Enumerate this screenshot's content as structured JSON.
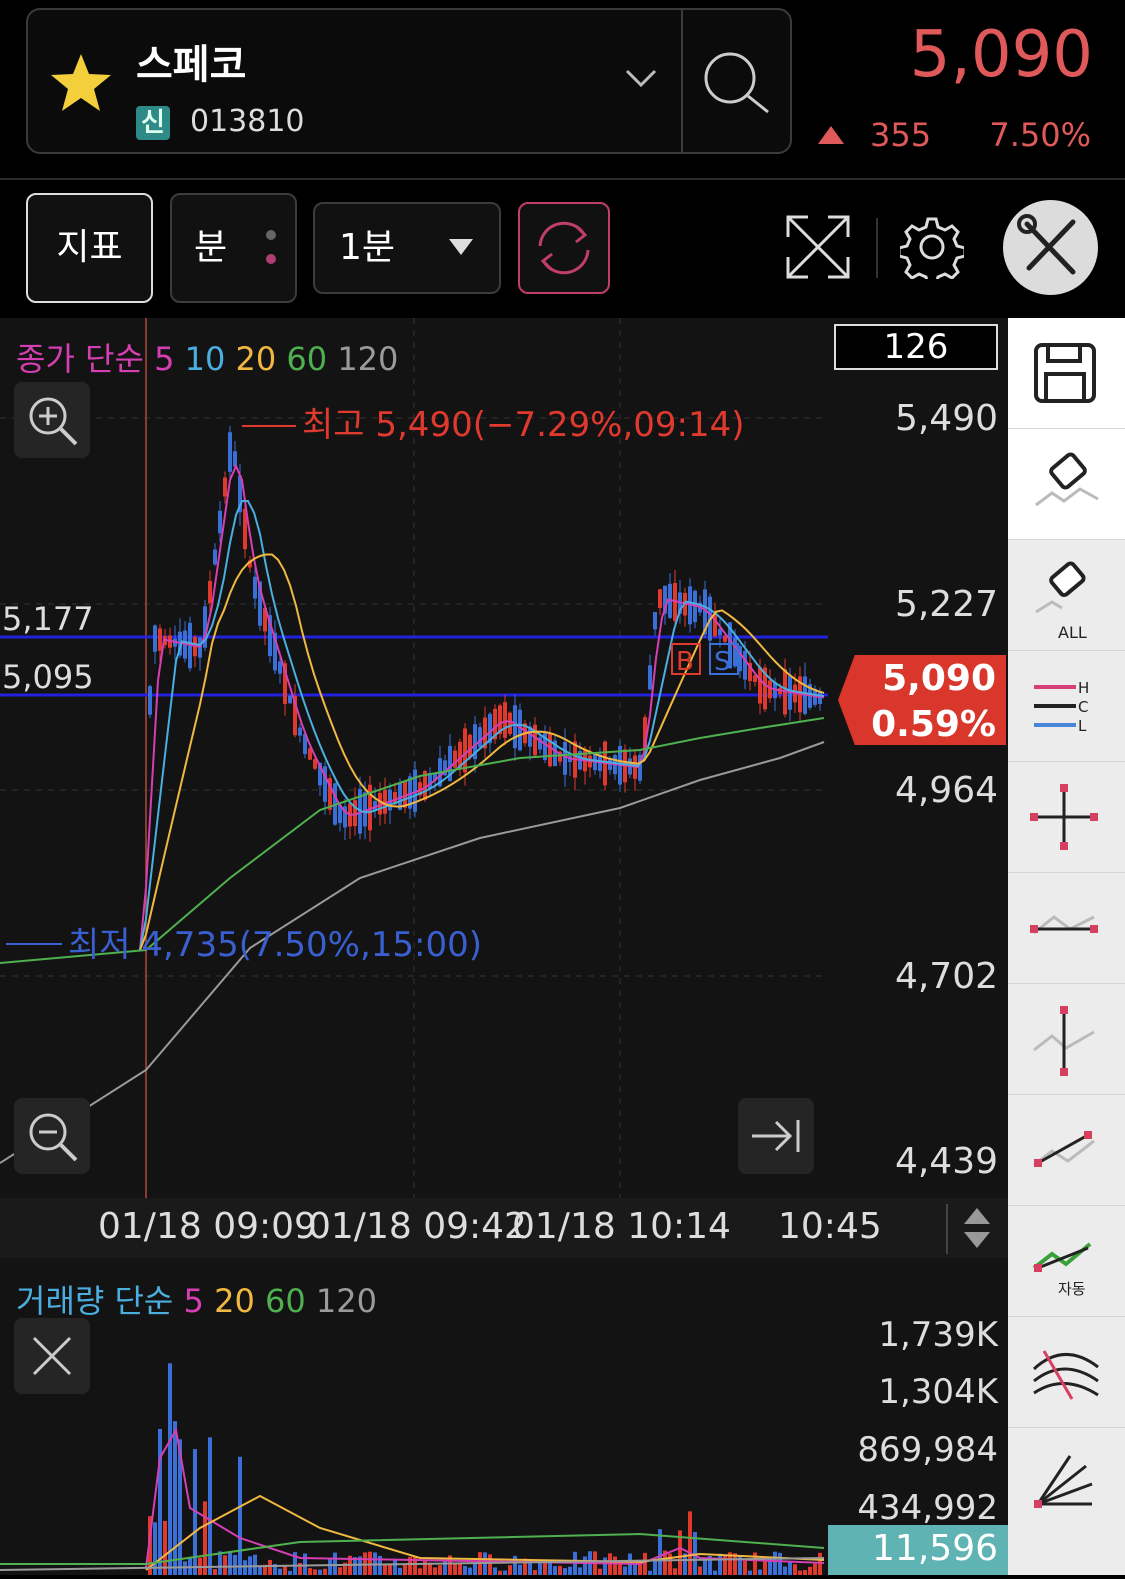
{
  "header": {
    "stock_name": "스페코",
    "credit_badge": "신",
    "stock_code": "013810",
    "price": "5,090",
    "change_abs": "355",
    "change_pct": "7.50%",
    "price_color": "#e0595a"
  },
  "toolbar": {
    "indicator_label": "지표",
    "minute_label": "분",
    "period_value": "1분",
    "icons": [
      "refresh-icon",
      "expand-icon",
      "settings-icon",
      "tools-icon"
    ]
  },
  "chart": {
    "ma_legend": {
      "prefix": "종가 단순",
      "p5": "5",
      "p10": "10",
      "p20": "20",
      "p60": "60",
      "p120": "120"
    },
    "ma_colors": {
      "p5": "#d63fb4",
      "p10": "#4aaee0",
      "p20": "#f0b840",
      "p60": "#4fb04f",
      "p120": "#9a9a9a"
    },
    "visible_count": "126",
    "y_ticks": [
      "5,490",
      "5,227",
      "4,964",
      "4,702",
      "4,439"
    ],
    "hlines": [
      "5,177",
      "5,095"
    ],
    "high_annotation": "최고 5,490(−7.29%,09:14)",
    "low_annotation": "최저 4,735(7.50%,15:00)",
    "signal_buy": "B",
    "signal_sell": "S",
    "current_price": "5,090",
    "current_pct": "0.59%",
    "x_ticks": [
      "01/18 09:09",
      "01/18 09:42",
      "01/18 10:14",
      "10:45"
    ]
  },
  "volume": {
    "legend": {
      "prefix": "거래량 단순",
      "p5": "5",
      "p20": "20",
      "p60": "60",
      "p120": "120"
    },
    "y_ticks": [
      "1,739K",
      "1,304K",
      "869,984",
      "434,992"
    ],
    "current": "11,596"
  },
  "side_tools": [
    "save-icon",
    "eraser-icon",
    "eraser-all-icon",
    "hcl-lines-icon",
    "crosshair-icon",
    "horizontal-line-icon",
    "vertical-line-icon",
    "trend-line-icon",
    "auto-trend-icon",
    "fan-arc-icon",
    "speed-fan-icon"
  ],
  "side_labels": {
    "all": "ALL",
    "h": "H",
    "c": "C",
    "l": "L",
    "auto": "자동"
  }
}
